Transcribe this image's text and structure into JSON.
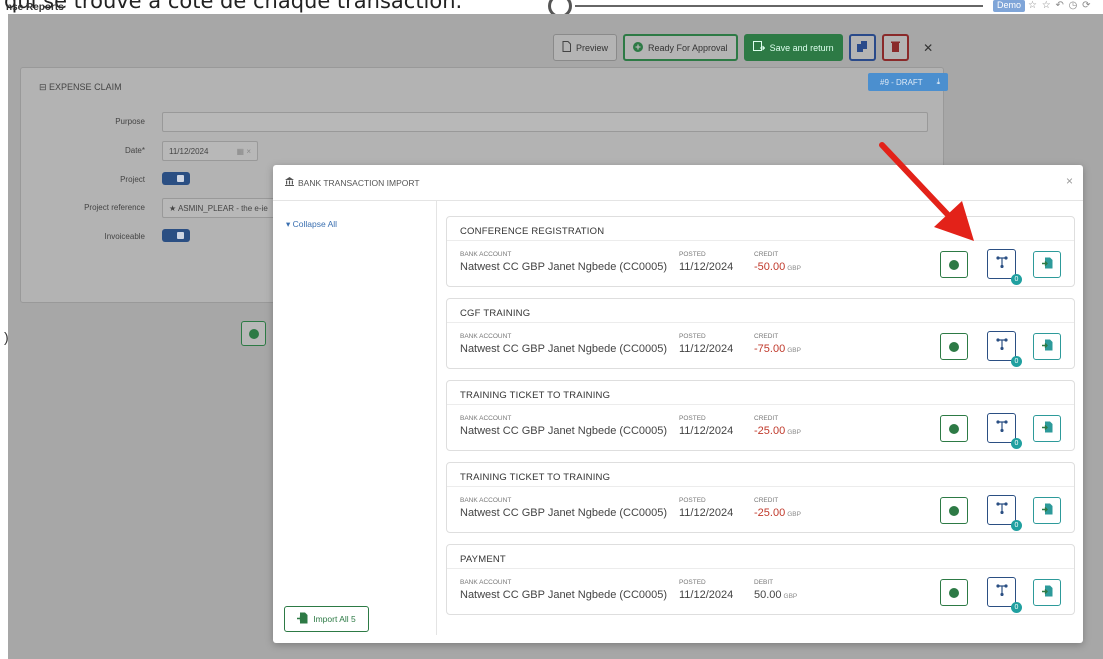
{
  "caption": {
    "text": "qui se trouve à côté de chaque transaction."
  },
  "app": {
    "title": "nse Reports",
    "env_badge": "Demo"
  },
  "toolbar": {
    "preview_label": "Preview",
    "ready_label": "Ready For Approval",
    "save_label": "Save and return"
  },
  "claim": {
    "section_title": "EXPENSE CLAIM",
    "status_tag": "#9 - DRAFT",
    "fields": {
      "purpose_label": "Purpose",
      "purpose_value": "",
      "date_label": "Date*",
      "date_value": "11/12/2024",
      "project_label": "Project",
      "project_ref_label": "Project reference",
      "project_ref_value": "ASMIN_PLEAR - the e-ie",
      "invoiceable_label": "Invoiceable"
    }
  },
  "modal": {
    "title": "BANK TRANSACTION IMPORT",
    "collapse_all": "Collapse All",
    "import_all": "Import All 5",
    "transactions": [
      {
        "name": "CONFERENCE REGISTRATION",
        "account_label": "BANK ACCOUNT",
        "account": "Natwest CC GBP Janet Ngbede (CC0005)",
        "posted_label": "POSTED",
        "posted": "11/12/2024",
        "type_label": "CREDIT",
        "amount": "-50.00",
        "currency": "GBP",
        "badge": "0"
      },
      {
        "name": "CGF TRAINING",
        "account_label": "BANK ACCOUNT",
        "account": "Natwest CC GBP Janet Ngbede (CC0005)",
        "posted_label": "POSTED",
        "posted": "11/12/2024",
        "type_label": "CREDIT",
        "amount": "-75.00",
        "currency": "GBP",
        "badge": "0"
      },
      {
        "name": "TRAINING TICKET TO TRAINING",
        "account_label": "BANK ACCOUNT",
        "account": "Natwest CC GBP Janet Ngbede (CC0005)",
        "posted_label": "POSTED",
        "posted": "11/12/2024",
        "type_label": "CREDIT",
        "amount": "-25.00",
        "currency": "GBP",
        "badge": "0"
      },
      {
        "name": "TRAINING TICKET TO TRAINING",
        "account_label": "BANK ACCOUNT",
        "account": "Natwest CC GBP Janet Ngbede (CC0005)",
        "posted_label": "POSTED",
        "posted": "11/12/2024",
        "type_label": "CREDIT",
        "amount": "-25.00",
        "currency": "GBP",
        "badge": "0"
      },
      {
        "name": "PAYMENT",
        "account_label": "BANK ACCOUNT",
        "account": "Natwest CC GBP Janet Ngbede (CC0005)",
        "posted_label": "POSTED",
        "posted": "11/12/2024",
        "type_label": "DEBIT",
        "amount": "50.00",
        "currency": "GBP",
        "badge": "0"
      }
    ]
  },
  "icons": {
    "preview": "document-icon",
    "ready": "plus-circle-icon",
    "save": "save-return-icon",
    "copy": "copy-icon",
    "delete": "trash-icon",
    "close": "close-icon",
    "bank": "bank-icon",
    "add": "add-circle-icon",
    "split": "split-icon",
    "import": "file-import-icon",
    "annotation": "red-arrow-icon"
  },
  "colors": {
    "green": "#2d7a45",
    "blue": "#2b4f83",
    "teal": "#2d9a9a",
    "negative": "#c0392b",
    "arrow": "#e32219"
  }
}
